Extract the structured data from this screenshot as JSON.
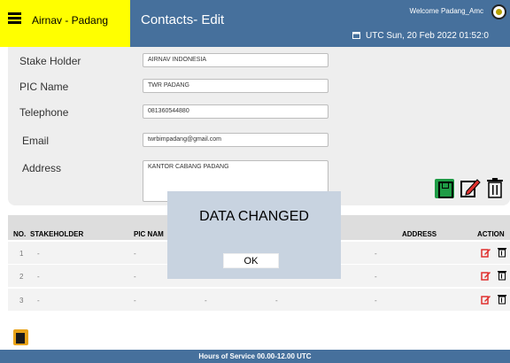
{
  "header": {
    "brand": "Airnav - Padang",
    "page_title": "Contacts- Edit",
    "welcome": "Welcome Padang_Amc",
    "datetime": "UTC Sun, 20 Feb 2022 01:52:0"
  },
  "form": {
    "fields": [
      {
        "label": "Stake Holder",
        "value": "AIRNAV INDONESIA"
      },
      {
        "label": "PIC Name",
        "value": "TWR PADANG"
      },
      {
        "label": "Telephone",
        "value": "081360544880"
      },
      {
        "label": "Email",
        "value": "twrbimpadang@gmail.com"
      },
      {
        "label": "Address",
        "value": "KANTOR CABANG PADANG"
      }
    ]
  },
  "table": {
    "headers": {
      "no": "NO.",
      "stakeholder": "STAKEHOLDER",
      "pic": "PIC NAM",
      "address": "ADDRESS",
      "action": "ACTION"
    },
    "rows": [
      {
        "no": "1",
        "stakeholder": "-",
        "pic": "-",
        "address": "-"
      },
      {
        "no": "2",
        "stakeholder": "-",
        "pic": "-",
        "address": "-"
      },
      {
        "no": "3",
        "stakeholder": "-",
        "pic": "-",
        "c3": "-",
        "c4": "-",
        "address": "-"
      }
    ]
  },
  "modal": {
    "message": "DATA CHANGED",
    "ok_label": "OK"
  },
  "footer": {
    "text": "Hours of Service 00.00-12.00 UTC"
  },
  "colors": {
    "brand_yellow": "#ffff00",
    "header_blue": "#46709c",
    "save_green": "#1f9c46",
    "edit_red": "#e0302e",
    "clipboard_orange": "#e8a319"
  },
  "icons": [
    "menu-icon",
    "avatar-icon",
    "calendar-icon",
    "save-icon",
    "edit-icon",
    "trash-icon",
    "clipboard-icon"
  ]
}
